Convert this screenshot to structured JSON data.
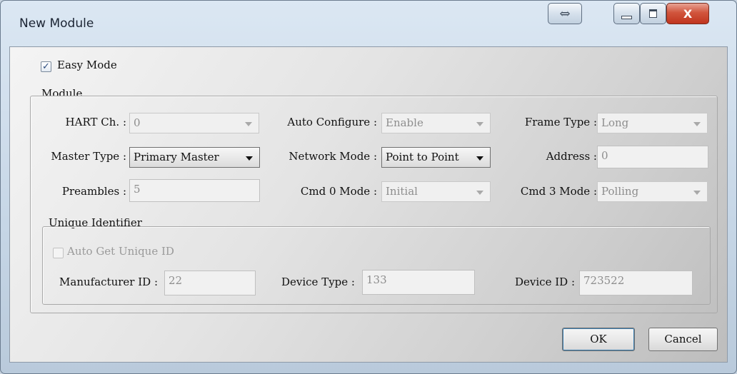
{
  "window": {
    "title": "New Module",
    "pin_glyph": "⇔",
    "close_glyph": "X"
  },
  "easy_mode": {
    "label": "Easy Mode",
    "checked": true
  },
  "module": {
    "legend": "Module",
    "hart_ch": {
      "label": "HART Ch. :",
      "value": "0"
    },
    "auto_configure": {
      "label": "Auto Configure :",
      "value": "Enable"
    },
    "frame_type": {
      "label": "Frame Type :",
      "value": "Long"
    },
    "master_type": {
      "label": "Master Type :",
      "value": "Primary Master"
    },
    "network_mode": {
      "label": "Network Mode :",
      "value": "Point to Point"
    },
    "address": {
      "label": "Address :",
      "value": "0"
    },
    "preambles": {
      "label": "Preambles :",
      "value": "5"
    },
    "cmd0_mode": {
      "label": "Cmd 0 Mode :",
      "value": "Initial"
    },
    "cmd3_mode": {
      "label": "Cmd 3 Mode :",
      "value": "Polling"
    }
  },
  "unique_identifier": {
    "legend": "Unique Identifier",
    "auto_get": {
      "label": "Auto Get Unique ID",
      "checked": false
    },
    "manufacturer_id": {
      "label": "Manufacturer ID :",
      "value": "22"
    },
    "device_type": {
      "label": "Device Type :",
      "value": "133"
    },
    "device_id": {
      "label": "Device ID :",
      "value": "723522"
    }
  },
  "buttons": {
    "ok": "OK",
    "cancel": "Cancel"
  },
  "icons": {
    "checkbox_check": "check-icon",
    "combo_arrow": "chevron-down-icon"
  }
}
